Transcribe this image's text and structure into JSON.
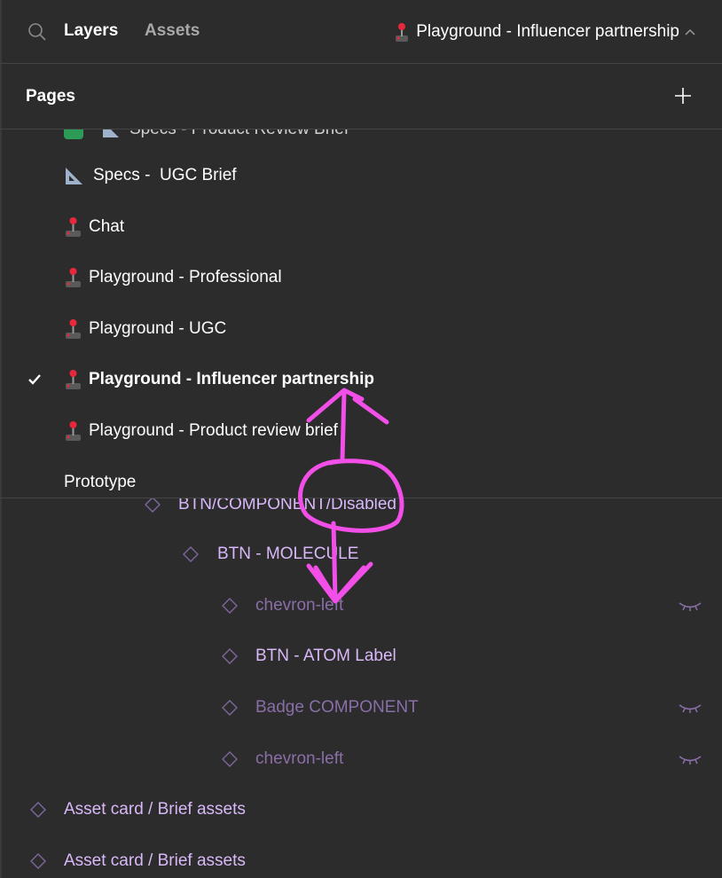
{
  "header": {
    "tabs": [
      {
        "label": "Layers",
        "active": true
      },
      {
        "label": "Assets",
        "active": false
      }
    ],
    "current_page": "Playground - Influencer partnership",
    "current_page_icon": "joystick-icon"
  },
  "pages": {
    "title": "Pages",
    "add_label": "+",
    "items": [
      {
        "label": "Specs - Product Review Brief",
        "icon": "spreadsheet-icon",
        "partial": true
      },
      {
        "label": "Specs -  UGC Brief",
        "icon": "triangle-ruler-icon"
      },
      {
        "label": "Chat",
        "icon": "joystick-icon"
      },
      {
        "label": "Playground - Professional",
        "icon": "joystick-icon"
      },
      {
        "label": "Playground - UGC",
        "icon": "joystick-icon"
      },
      {
        "label": "Playground - Influencer partnership",
        "icon": "joystick-icon",
        "selected": true
      },
      {
        "label": "Playground - Product review brief",
        "icon": "joystick-icon"
      },
      {
        "label": "Prototype",
        "icon": null
      }
    ]
  },
  "layers": [
    {
      "name": "BTN/COMPONENT/Disabled",
      "depth": 2,
      "hidden": false
    },
    {
      "name": "BTN - MOLECULE",
      "depth": 3,
      "hidden": false
    },
    {
      "name": "chevron-left",
      "depth": 4,
      "hidden": true
    },
    {
      "name": "BTN - ATOM Label",
      "depth": 4,
      "hidden": false
    },
    {
      "name": "Badge COMPONENT",
      "depth": 4,
      "hidden": true
    },
    {
      "name": "chevron-left",
      "depth": 4,
      "hidden": true
    },
    {
      "name": "Asset card / Brief assets",
      "depth": 0,
      "hidden": false
    },
    {
      "name": "Asset card / Brief assets",
      "depth": 0,
      "hidden": false
    }
  ],
  "annotation": {
    "type": "drag-arrow",
    "color": "#f24ee8",
    "direction": "bidirectional"
  }
}
